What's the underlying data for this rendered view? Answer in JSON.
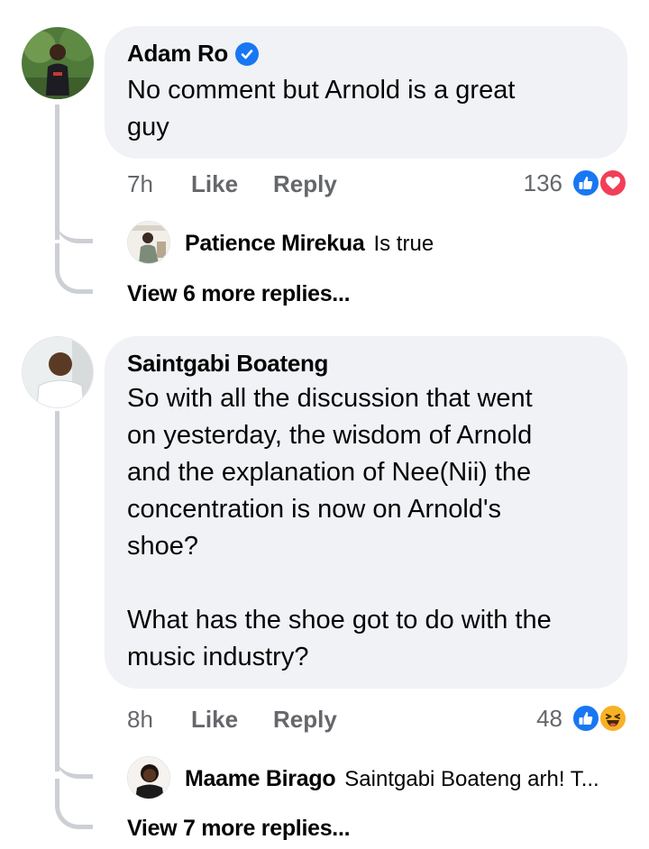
{
  "comments": [
    {
      "author": "Adam Ro",
      "verified": true,
      "text": "No comment but Arnold is a great\nguy",
      "time": "7h",
      "like_label": "Like",
      "reply_label": "Reply",
      "reaction_count": "136",
      "reactions": [
        "like-icon",
        "love-icon"
      ],
      "reply": {
        "author": "Patience Mirekua",
        "text": "Is true"
      },
      "view_more": "View 6 more replies..."
    },
    {
      "author": "Saintgabi Boateng",
      "verified": false,
      "text": "So with all the discussion that went\non yesterday, the wisdom of Arnold\nand the explanation of Nee(Nii) the\nconcentration is now on Arnold's\nshoe?\n\nWhat has the shoe got to do with the\nmusic industry?",
      "time": "8h",
      "like_label": "Like",
      "reply_label": "Reply",
      "reaction_count": "48",
      "reactions": [
        "like-icon",
        "haha-icon"
      ],
      "reply": {
        "author": "Maame Birago",
        "text": "Saintgabi Boateng arh! T..."
      },
      "view_more": "View 7 more replies..."
    }
  ],
  "colors": {
    "bubble": "#f0f2f5",
    "meta_text": "#65676b",
    "thread_line": "#ccd0d5",
    "like_blue": "#1877f2",
    "love_red": "#f33e58",
    "haha_yellow": "#f7b125"
  }
}
